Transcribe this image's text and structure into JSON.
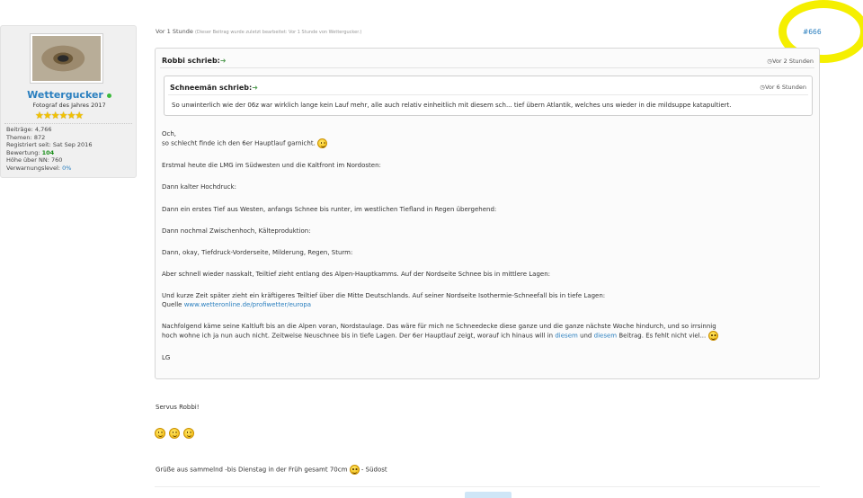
{
  "user": {
    "name": "Wettergucker",
    "title": "Fotograf des Jahres 2017",
    "stars": "★★★★★★",
    "stats": {
      "posts_label": "Beiträge:",
      "posts": "4,766",
      "topics_label": "Themen:",
      "topics": "872",
      "registered_label": "Registriert seit:",
      "registered": "Sat Sep 2016",
      "rating_label": "Bewertung:",
      "rating": "104",
      "height_label": "Höhe über NN:",
      "height": "760",
      "warning_label": "Verwarnungslevel:",
      "warning": "0%"
    }
  },
  "post": {
    "time": "Vor 1 Stunde",
    "edit_note": "(Dieser Beitrag wurde zuletzt bearbeitet: Vor 1 Stunde von Wettergucker.)",
    "number": "#666"
  },
  "quote": {
    "author": "Robbi schrieb:",
    "time": "Vor 2 Stunden",
    "inner": {
      "author": "Schneemän schrieb:",
      "time": "Vor 6 Stunden",
      "text": "So unwinterlich wie der 06z war wirklich lange kein Lauf mehr, alle auch relativ einheitlich mit diesem sch... tief übern Atlantik, welches uns wieder in die mildsuppe katapultiert."
    },
    "lines": {
      "och": "Och,",
      "schlecht": "so schlecht finde ich den 6er Hauptlauf garnicht.",
      "erstmal": "Erstmal heute die LMG im Südwesten und die Kaltfront im Nordosten:",
      "hochdruck": "Dann kalter Hochdruck:",
      "tief": "Dann ein erstes Tief aus Westen, anfangs Schnee bis runter, im westlichen Tiefland in Regen übergehend:",
      "zwischenhoch": "Dann nochmal Zwischenhoch, Kälteproduktion:",
      "okay": "Dann, okay, Tiefdruck-Vorderseite, Milderung, Regen, Sturm:",
      "nasskalt": "Aber schnell wieder nasskalt, Teiltief zieht entlang des Alpen-Hauptkamms. Auf der Nordseite Schnee bis in mittlere Lagen:",
      "kurze": "Und kurze Zeit später zieht ein kräftigeres Teiltief über die Mitte Deutschlands. Auf seiner Nordseite Isothermie-Schneefall bis in tiefe Lagen:",
      "quelle_label": "Quelle",
      "quelle_link": "www.wetteronline.de/profiwetter/europa",
      "nach1": "Nachfolgend käme seine Kaltluft bis an die Alpen voran, Nordstaulage. Das wäre für mich ne Schneedecke diese ganze und die ganze nächste Woche hindurch, und so irrsinnig",
      "nach2a": "hoch wohne ich ja nun auch nicht. Zeitweise Neuschnee bis in tiefe Lagen. Der 6er Hauptlauf zeigt, worauf ich hinaus will in",
      "link_diesem1": "diesem",
      "und": "und",
      "link_diesem2": "diesem",
      "nach2b": "Beitrag. Es fehlt nicht viel...",
      "lg": "LG"
    }
  },
  "reply": {
    "greeting": "Servus Robbi!",
    "closing": "Grüße aus sammelnd -bis Dienstag in der Früh gesamt 70cm",
    "closing_suffix": "- Südost"
  },
  "colors": {
    "link": "#2a7fbf",
    "highlight": "#f5ef00",
    "online": "#3cba3c",
    "rating": "#1a8f1a"
  }
}
